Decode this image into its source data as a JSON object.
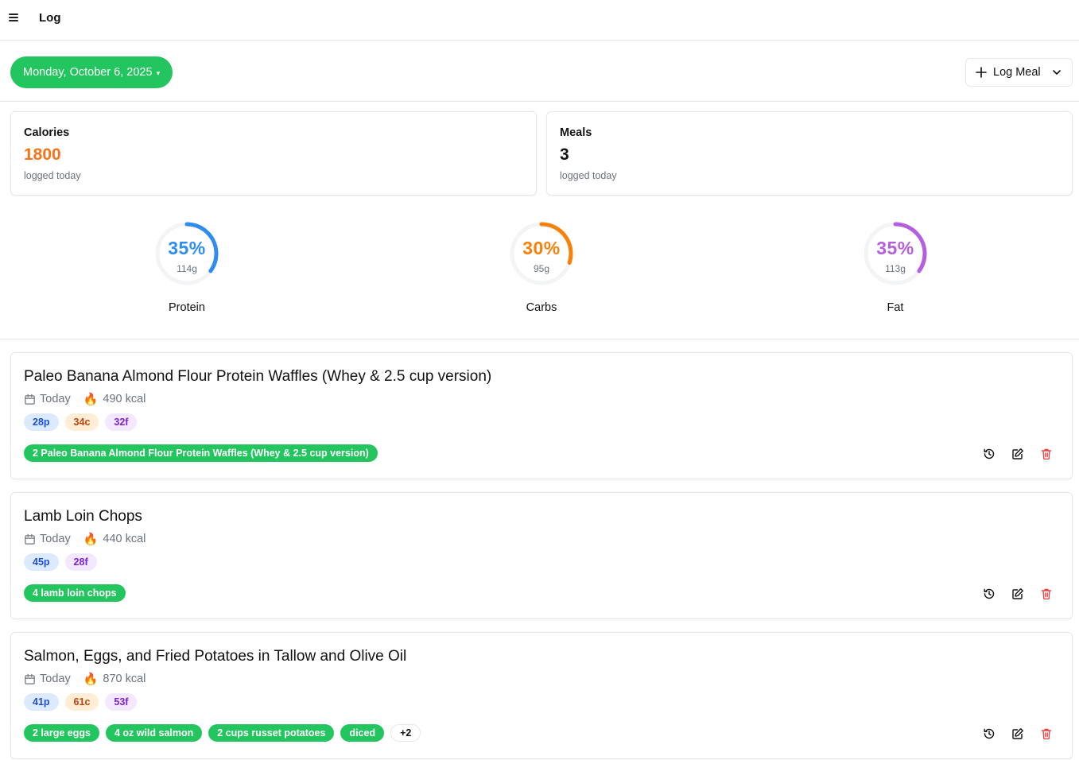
{
  "header": {
    "title": "Log"
  },
  "date_selector": {
    "label": "Monday, October 6, 2025",
    "caret": "▾"
  },
  "log_meal_button": {
    "label": "Log Meal"
  },
  "stats": [
    {
      "label": "Calories",
      "value": "1800",
      "sub": "logged today",
      "color": "#f97316"
    },
    {
      "label": "Meals",
      "value": "3",
      "sub": "logged today",
      "color": "#111111"
    }
  ],
  "macros": [
    {
      "name": "Protein",
      "percent": "35%",
      "grams": "114g",
      "fraction": 0.35,
      "color": "#2f8cf0"
    },
    {
      "name": "Carbs",
      "percent": "30%",
      "grams": "95g",
      "fraction": 0.3,
      "color": "#f7810b"
    },
    {
      "name": "Fat",
      "percent": "35%",
      "grams": "113g",
      "fraction": 0.35,
      "color": "#b45ee0"
    }
  ],
  "meals": [
    {
      "title": "Paleo Banana Almond Flour Protein Waffles (Whey & 2.5 cup version)",
      "date": "Today",
      "kcal": "490 kcal",
      "macros": {
        "p": "28p",
        "c": "34c",
        "f": "32f"
      },
      "items": [
        "2 Paleo Banana Almond Flour Protein Waffles (Whey & 2.5 cup version)"
      ],
      "more": ""
    },
    {
      "title": "Lamb Loin Chops",
      "date": "Today",
      "kcal": "440 kcal",
      "macros": {
        "p": "45p",
        "c": "",
        "f": "28f"
      },
      "items": [
        "4 lamb loin chops"
      ],
      "more": ""
    },
    {
      "title": "Salmon, Eggs, and Fried Potatoes in Tallow and Olive Oil",
      "date": "Today",
      "kcal": "870 kcal",
      "macros": {
        "p": "41p",
        "c": "61c",
        "f": "53f"
      },
      "items": [
        "2 large eggs",
        "4 oz wild salmon",
        "2 cups russet potatoes",
        "diced"
      ],
      "more": "+2"
    }
  ],
  "icons": {
    "menu": "menu-icon",
    "plus": "plus-icon",
    "chevron": "chevron-down-icon",
    "calendar": "calendar-icon",
    "fire": "fire-icon",
    "history": "history-icon",
    "edit": "edit-icon",
    "delete": "trash-icon"
  },
  "colors": {
    "accent": "#22c55e",
    "delete": "#ef4444"
  }
}
